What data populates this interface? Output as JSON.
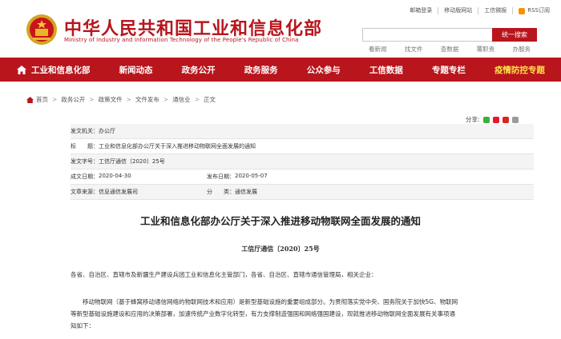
{
  "header": {
    "title": "中华人民共和国工业和信息化部",
    "subtitle": "Ministry of Industry and Information Technology of the People's Republic of China",
    "toplinks": [
      "邮箱登录",
      "移动版网站",
      "工信微报",
      "RSS订阅"
    ],
    "search": {
      "placeholder": "",
      "button": "统一搜索"
    },
    "hotwords": [
      "看新闻",
      "找文件",
      "查数据",
      "覆职责",
      "办服务"
    ]
  },
  "nav": [
    "工业和信息化部",
    "新闻动态",
    "政务公开",
    "政务服务",
    "公众参与",
    "工信数据",
    "专题专栏",
    "疫情防控专题"
  ],
  "breadcrumb": [
    "首页",
    "政务公开",
    "政策文件",
    "文件发布",
    "通信业",
    "正文"
  ],
  "share": {
    "label": "分享:"
  },
  "info": {
    "issuer_k": "发文机关：",
    "issuer_v": "办公厅",
    "title_k": "标　　题：",
    "title_v": "工业和信息化部办公厅关于深入推进移动物联网全面发展的通知",
    "docno_k": "发文字号：",
    "docno_v": "工信厅通信〔2020〕25号",
    "written_k": "成文日期：",
    "written_v": "2020-04-30",
    "published_k": "发布日期：",
    "published_v": "2020-05-07",
    "source_k": "文章来源：",
    "source_v": "信息通信发展司",
    "category_k": "分　　类：",
    "category_v": "通信发展"
  },
  "doc": {
    "title": "工业和信息化部办公厅关于深入推进移动物联网全面发展的通知",
    "number": "工信厅通信〔2020〕25号",
    "salutation": "各省、自治区、直辖市及新疆生产建设兵团工业和信息化主管部门，各省、自治区、直辖市通信管理局，相关企业：",
    "para1_l1": "　　移动物联网（基于蜂窝移动通信网络的物联网技术和应用）是新型基础设施的重要组成部分。为贯彻落实党中央、国务院关于加快5G、物联网",
    "para1_l2": "等新型基础设施建设和应用的决策部署，加速传统产业数字化转型，有力支撑制造强国和网络强国建设，现就推进移动物联网全面发展有关事项通",
    "para1_l3": "知如下："
  }
}
